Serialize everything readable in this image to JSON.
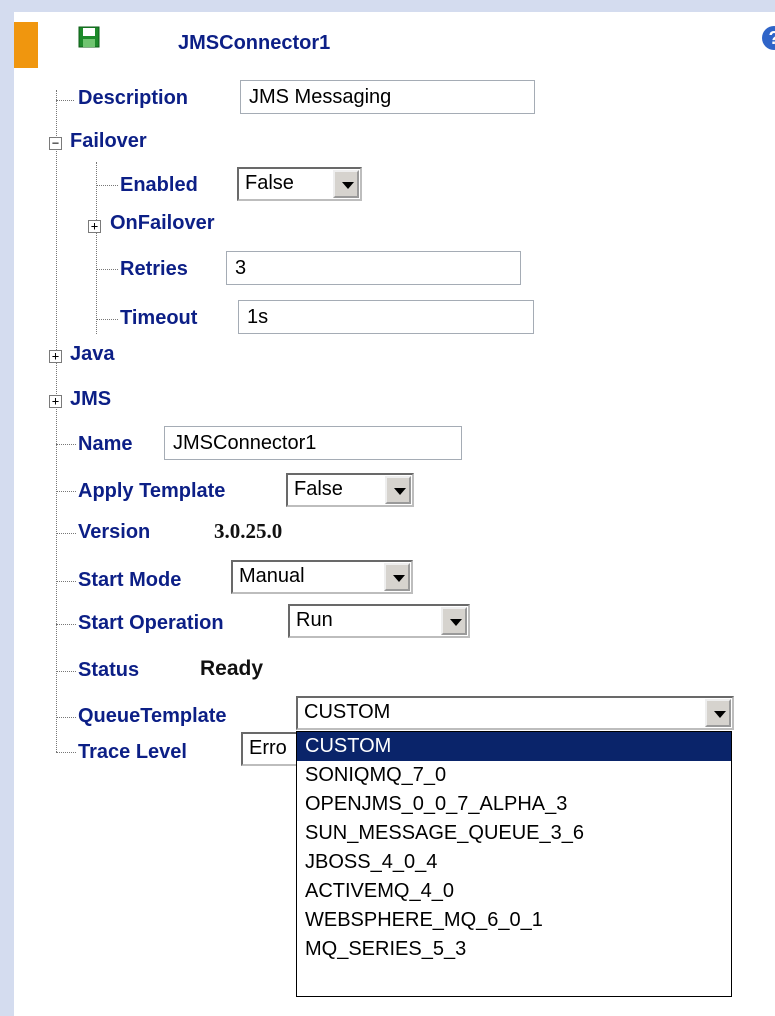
{
  "header": {
    "title": "JMSConnector1",
    "help_icon": "?"
  },
  "tree": {
    "description": {
      "label": "Description",
      "value": "JMS Messaging"
    },
    "failover": {
      "label": "Failover",
      "expander": "−",
      "enabled": {
        "label": "Enabled",
        "value": "False"
      },
      "onfailover": {
        "label": "OnFailover",
        "expander": "+"
      },
      "retries": {
        "label": "Retries",
        "value": "3"
      },
      "timeout": {
        "label": "Timeout",
        "value": "1s"
      }
    },
    "java": {
      "label": "Java",
      "expander": "+"
    },
    "jms": {
      "label": "JMS",
      "expander": "+"
    },
    "name": {
      "label": "Name",
      "value": "JMSConnector1"
    },
    "apply_template": {
      "label": "Apply Template",
      "value": "False"
    },
    "version": {
      "label": "Version",
      "value": "3.0.25.0"
    },
    "start_mode": {
      "label": "Start Mode",
      "value": "Manual"
    },
    "start_operation": {
      "label": "Start Operation",
      "value": "Run"
    },
    "status": {
      "label": "Status",
      "value": "Ready"
    },
    "queue_template": {
      "label": "QueueTemplate",
      "value": "CUSTOM",
      "options": [
        "CUSTOM",
        "SONIQMQ_7_0",
        "OPENJMS_0_0_7_ALPHA_3",
        "SUN_MESSAGE_QUEUE_3_6",
        "JBOSS_4_0_4",
        "ACTIVEMQ_4_0",
        "WEBSPHERE_MQ_6_0_1",
        "MQ_SERIES_5_3"
      ],
      "selected_index": 0
    },
    "trace_level": {
      "label": "Trace Level",
      "value": "Erro"
    }
  },
  "colors": {
    "accent": "#f0960e",
    "label": "#0c1f86",
    "selection": "#0a246a",
    "background": "#d4dcef"
  },
  "icons": {
    "save": "save-icon",
    "help": "help-icon"
  }
}
